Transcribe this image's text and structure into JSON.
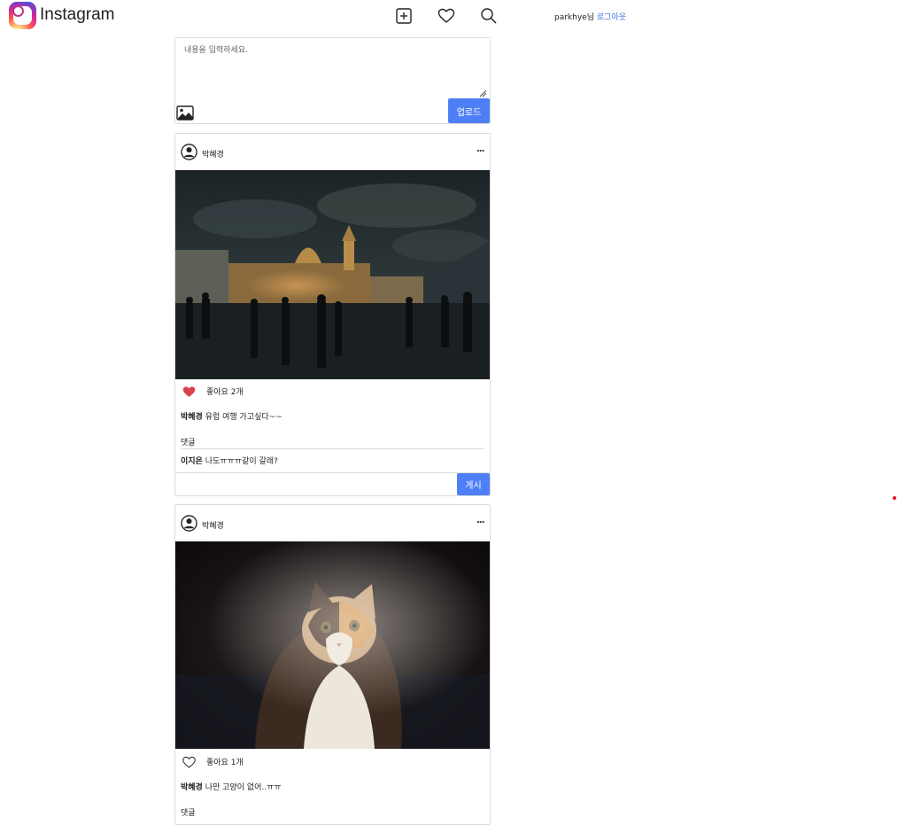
{
  "header": {
    "logo_text": "Instagram",
    "user_name": "parkhye",
    "user_suffix": "님",
    "logout_label": "로그아웃",
    "icons": [
      "add-post-icon",
      "heart-icon",
      "search-icon"
    ]
  },
  "compose": {
    "placeholder": "내용을 입력하세요.",
    "upload_label": "업로드"
  },
  "posts": [
    {
      "author": "박혜경",
      "more": "...",
      "liked": true,
      "likes_text": "좋아요 2개",
      "caption_author": "박혜경",
      "caption_text": " 유럽 여행 가고싶다~~",
      "comment_label": "댓글",
      "comments": [
        {
          "author": "이지은",
          "text": " 나도ㅠㅠㅠ같이 갈래?"
        }
      ],
      "post_label": "게시"
    },
    {
      "author": "박혜경",
      "more": "...",
      "liked": false,
      "likes_text": "좋아요 1개",
      "caption_author": "박혜경",
      "caption_text": " 나만 고양이 없어..ㅠㅠ",
      "comment_label": "댓글"
    }
  ],
  "colors": {
    "accent": "#4f7ff7",
    "link": "#3b6fe0",
    "liked_heart": "#d9434b",
    "border": "#dbdbdb"
  }
}
